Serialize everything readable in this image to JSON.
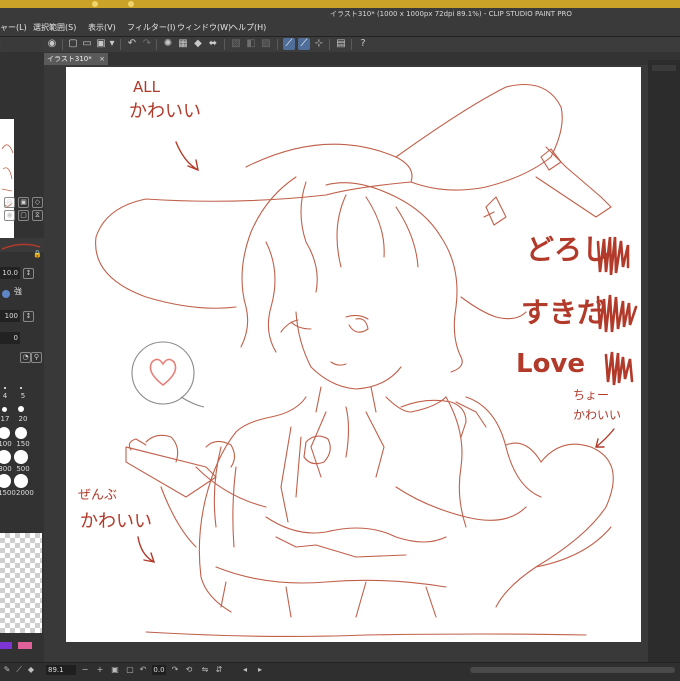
{
  "window": {
    "title": "イラスト310* (1000 x 1000px 72dpi 89.1%) - CLIP STUDIO PAINT PRO"
  },
  "menu": {
    "items": [
      "ャー(L)",
      "選択範囲(S)",
      "表示(V)",
      "フィルター(I)",
      "ウィンドウ(W)",
      "ヘルプ(H)"
    ]
  },
  "tabs": {
    "doc_title": "イラスト310*",
    "close_glyph": "×"
  },
  "left_panel": {
    "brush_size": "10.0",
    "strength_label": "強",
    "opacity": "100",
    "value3": "0",
    "size_list": [
      "4",
      "5",
      "17",
      "20",
      "100",
      "150",
      "300",
      "500",
      "1500",
      "2000"
    ]
  },
  "status": {
    "zoom": "89.1",
    "zoom_value": "0.0"
  },
  "canvas": {
    "texts": {
      "all": "ALL",
      "kawaii1": "かわいい",
      "dorosi": "どろし",
      "sukida": "すきだ",
      "love": "Love",
      "choo": "ちょー",
      "kawaii2": "かわいい",
      "zenbu": "ぜんぶ",
      "kawaii3": "かわいい"
    }
  },
  "colors": {
    "sketch": "#c0604a",
    "text_red": "#b23a2a",
    "heart": "#e8807a",
    "accent_blue": "#4f6f9a",
    "swatch_purple": "#7d35d6",
    "swatch_pink": "#e0609a"
  },
  "icons": [
    "undo-icon",
    "redo-icon",
    "new-file-icon",
    "open-folder-icon",
    "save-icon",
    "ruler-icon",
    "close-icon",
    "zoom-in-icon",
    "zoom-out-icon",
    "rotate-icon"
  ]
}
